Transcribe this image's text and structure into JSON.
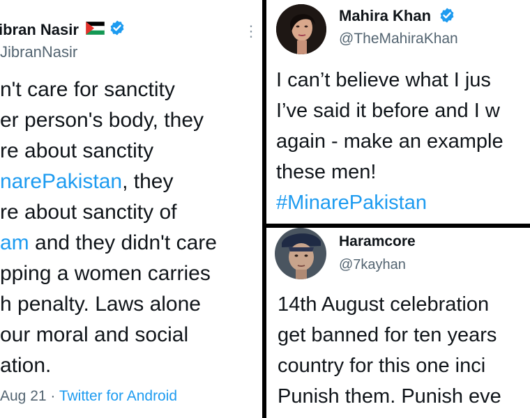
{
  "tweets": {
    "left": {
      "name": "ibran Nasir",
      "handle": "JibranNasir",
      "lines": [
        {
          "parts": [
            {
              "text": "n't care for sanctity"
            }
          ]
        },
        {
          "parts": [
            {
              "text": "er person's body, they"
            }
          ]
        },
        {
          "parts": [
            {
              "text": "re about sanctity"
            }
          ]
        },
        {
          "parts": [
            {
              "text": "narePakistan",
              "tag": true
            },
            {
              "text": ", they"
            }
          ]
        },
        {
          "parts": [
            {
              "text": "re about sanctity of"
            }
          ]
        },
        {
          "parts": [
            {
              "text": "am",
              "tag": true
            },
            {
              "text": " and they didn't care"
            }
          ]
        },
        {
          "parts": [
            {
              "text": "pping a women carries"
            }
          ]
        },
        {
          "parts": [
            {
              "text": "h penalty. Laws alone"
            }
          ]
        },
        {
          "parts": [
            {
              "text": "our moral and social"
            }
          ]
        },
        {
          "parts": [
            {
              "text": "ation."
            }
          ]
        }
      ],
      "footer_date": "Aug 21 · ",
      "footer_source": "Twitter for Android",
      "more_label": "⋮"
    },
    "right_top": {
      "name": "Mahira Khan",
      "handle": "@TheMahiraKhan",
      "lines": [
        {
          "parts": [
            {
              "text": "I can’t believe what I jus"
            }
          ]
        },
        {
          "parts": [
            {
              "text": "I’ve said it before and I w"
            }
          ]
        },
        {
          "parts": [
            {
              "text": "again - make an example"
            }
          ]
        },
        {
          "parts": [
            {
              "text": "these men!"
            }
          ]
        },
        {
          "parts": [
            {
              "text": " #MinarePakistan",
              "tag": true
            }
          ]
        }
      ]
    },
    "right_bottom": {
      "name": "Haramcore",
      "handle": "@7kayhan",
      "lines": [
        {
          "parts": [
            {
              "text": "14th August celebration"
            }
          ]
        },
        {
          "parts": [
            {
              "text": "get banned for ten years"
            }
          ]
        },
        {
          "parts": [
            {
              "text": "country for this one inci"
            }
          ]
        },
        {
          "parts": [
            {
              "text": "Punish them. Punish eve"
            }
          ]
        }
      ]
    }
  },
  "colors": {
    "text": "#0f1419",
    "secondary": "#536471",
    "link": "#1d9bf0",
    "verified": "#1d9bf0",
    "divider": "#000000"
  },
  "icons": {
    "verified": "verified-badge-icon",
    "flag": "palestine-flag-icon",
    "more": "more-options-icon"
  }
}
